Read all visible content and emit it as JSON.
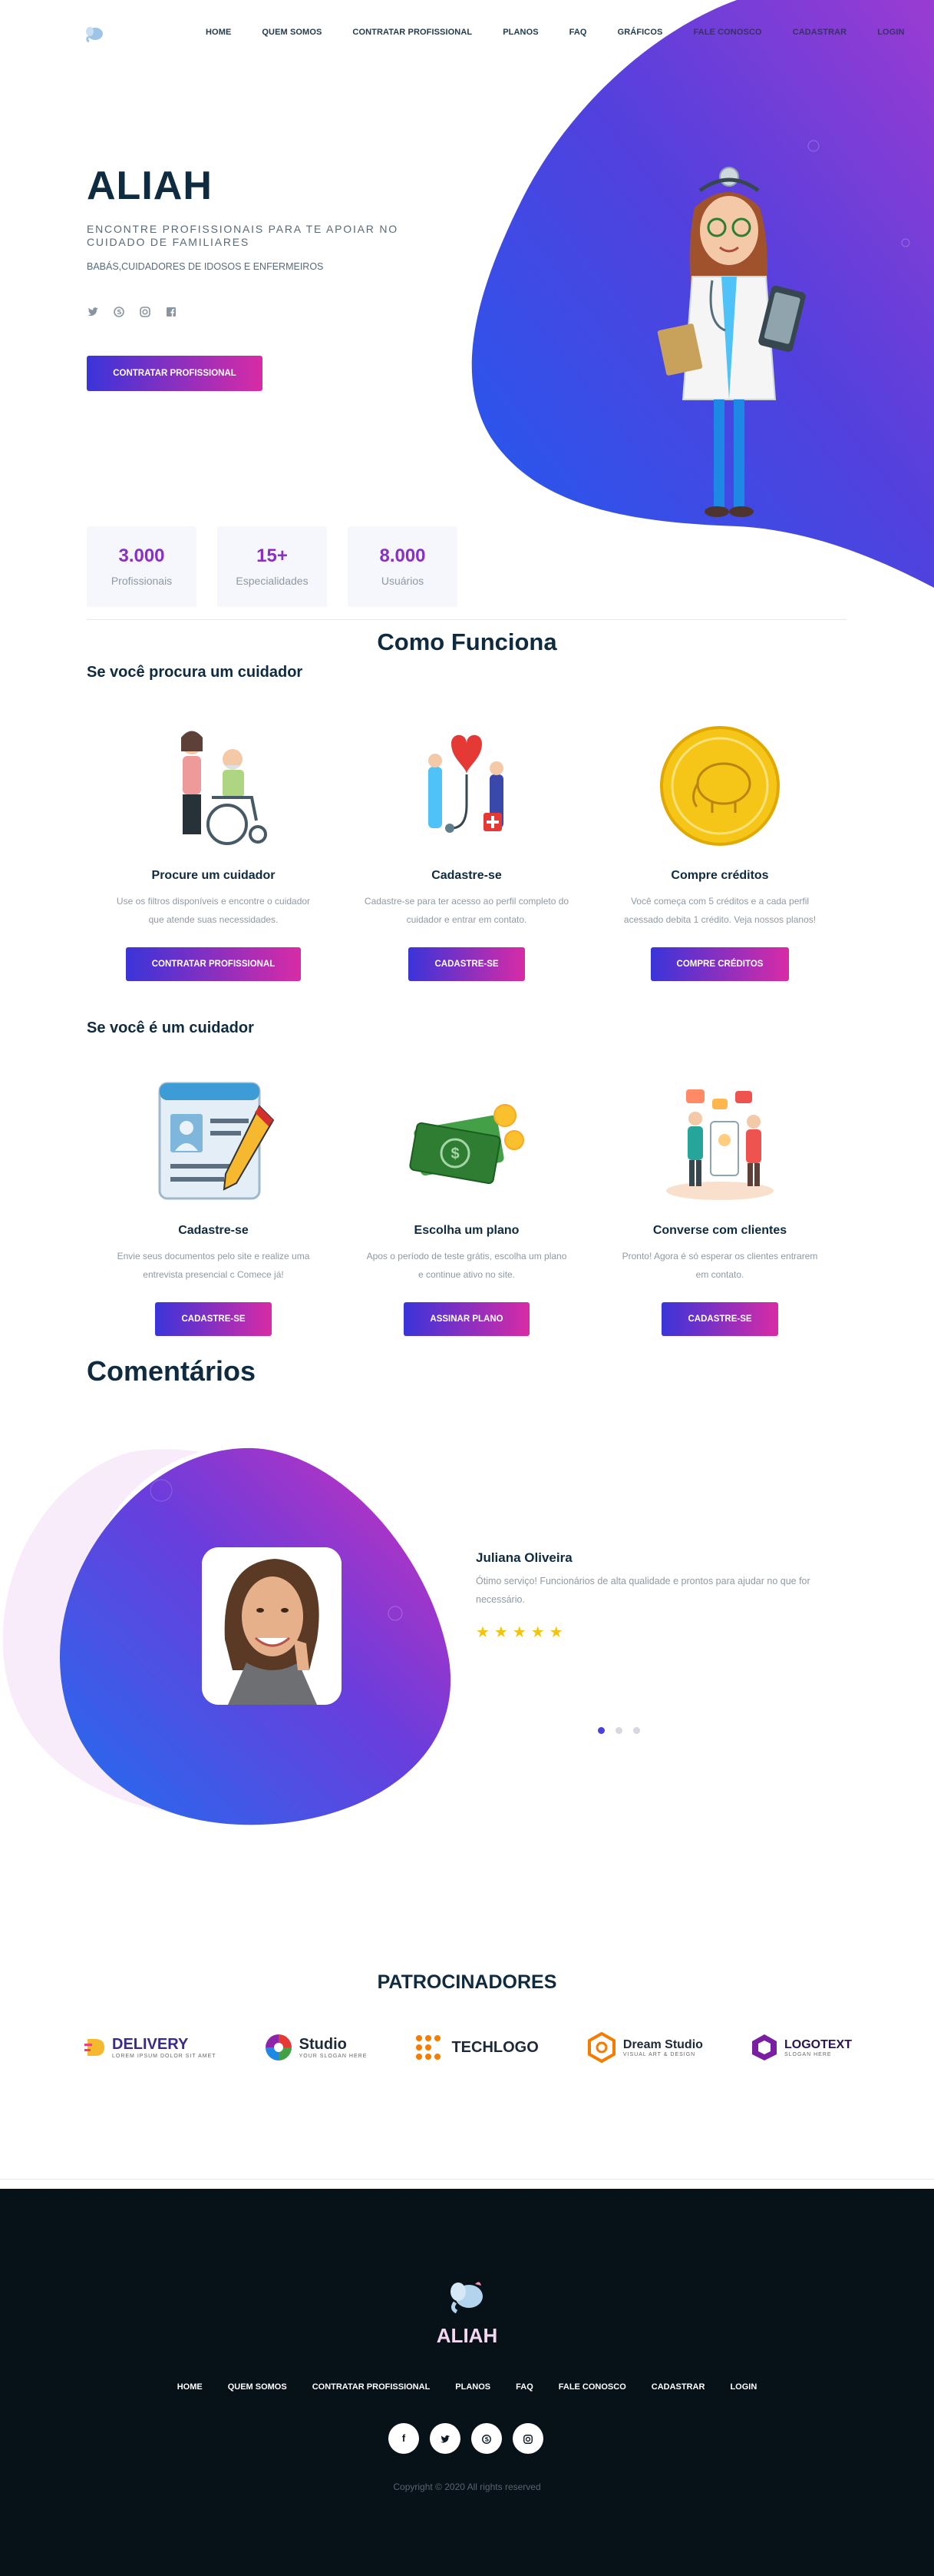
{
  "nav": {
    "items": [
      "HOME",
      "QUEM SOMOS",
      "CONTRATAR PROFISSIONAL",
      "PLANOS",
      "FAQ",
      "GRÁFICOS",
      "FALE CONOSCO",
      "CADASTRAR",
      "LOGIN"
    ]
  },
  "hero": {
    "title": "ALIAH",
    "subtitle": "ENCONTRE PROFISSIONAIS PARA TE APOIAR NO CUIDADO DE FAMILIARES",
    "tagline": "BABÁS,CUIDADORES DE IDOSOS E ENFERMEIROS",
    "cta": "CONTRATAR PROFISSIONAL",
    "socials": [
      "twitter-icon",
      "skype-icon",
      "instagram-icon",
      "facebook-icon"
    ]
  },
  "stats": [
    {
      "value": "3.000",
      "label": "Profissionais"
    },
    {
      "value": "15+",
      "label": "Especialidades"
    },
    {
      "value": "8.000",
      "label": "Usuários"
    }
  ],
  "how": {
    "title": "Como Funciona",
    "seeker_title": "Se você procura um cuidador",
    "seeker_cards": [
      {
        "title": "Procure um cuidador",
        "text": "Use os filtros disponíveis e encontre o cuidador que atende suas necessidades.",
        "button": "CONTRATAR PROFISSIONAL"
      },
      {
        "title": "Cadastre-se",
        "text": "Cadastre-se para ter acesso ao perfil completo do cuidador e entrar em contato.",
        "button": "CADASTRE-SE"
      },
      {
        "title": "Compre créditos",
        "text": "Você começa com 5 créditos e a cada perfil acessado debita 1 crédito. Veja nossos planos!",
        "button": "COMPRE CRÉDITOS"
      }
    ],
    "caregiver_title": "Se você é um cuidador",
    "caregiver_cards": [
      {
        "title": "Cadastre-se",
        "text": "Envie seus documentos pelo site e realize uma entrevista presencial c Comece já!",
        "button": "CADASTRE-SE"
      },
      {
        "title": "Escolha um plano",
        "text": "Apos o período de teste grátis, escolha um plano e continue ativo no site.",
        "button": "ASSINAR PLANO"
      },
      {
        "title": "Converse com clientes",
        "text": "Pronto! Agora é só esperar os clientes entrarem em contato.",
        "button": "CADASTRE-SE"
      }
    ]
  },
  "comments": {
    "title": "Comentários",
    "name": "Juliana Oliveira",
    "text": "Ótimo serviço! Funcionários de alta qualidade e prontos para ajudar no que for necessário.",
    "rating": 5,
    "stars": "★★★★★"
  },
  "sponsors": {
    "title": "PATROCINADORES",
    "logos": [
      {
        "name": "DELIVERY",
        "small": "LOREM IPSUM DOLOR SIT AMET"
      },
      {
        "name": "Studio",
        "small": "YOUR SLOGAN HERE"
      },
      {
        "name": "TECHLOGO",
        "small": ""
      },
      {
        "name": "Dream Studio",
        "small": "VISUAL ART & DESIGN"
      },
      {
        "name": "LOGOTEXT",
        "small": "SLOGAN HERE"
      }
    ]
  },
  "footer": {
    "title": "ALIAH",
    "nav": [
      "HOME",
      "QUEM SOMOS",
      "CONTRATAR PROFISSIONAL",
      "PLANOS",
      "FAQ",
      "FALE CONOSCO",
      "CADASTRAR",
      "LOGIN"
    ],
    "socials": [
      "f",
      "t",
      "s",
      "i"
    ],
    "copyright": "Copyright © 2020 All rights reserved"
  },
  "colors": {
    "primary_gradient_start": "#3a34d9",
    "primary_gradient_end": "#d82ba6",
    "heading": "#0f2b3f",
    "stat_number": "#8a2fc3",
    "footer_bg": "#071118"
  }
}
